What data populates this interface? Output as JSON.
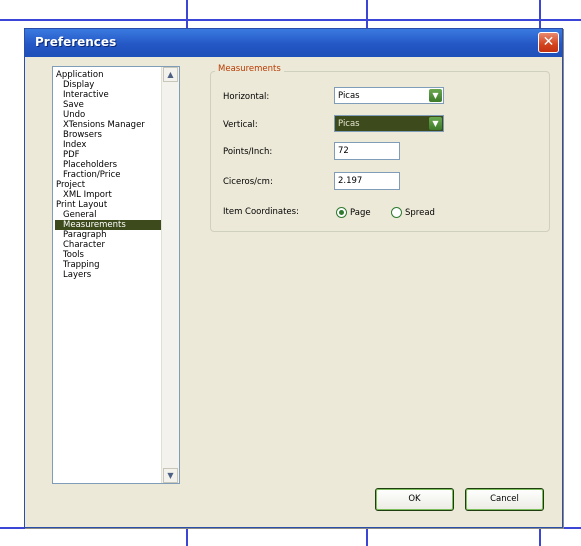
{
  "window": {
    "title": "Preferences",
    "close_glyph": "✕"
  },
  "tree": {
    "items": [
      {
        "label": "Application",
        "level": 0
      },
      {
        "label": "Display",
        "level": 1
      },
      {
        "label": "Interactive",
        "level": 1
      },
      {
        "label": "Save",
        "level": 1
      },
      {
        "label": "Undo",
        "level": 1
      },
      {
        "label": "XTensions Manager",
        "level": 1
      },
      {
        "label": "Browsers",
        "level": 1
      },
      {
        "label": "Index",
        "level": 1
      },
      {
        "label": "PDF",
        "level": 1
      },
      {
        "label": "Placeholders",
        "level": 1
      },
      {
        "label": "Fraction/Price",
        "level": 1
      },
      {
        "label": "Project",
        "level": 0
      },
      {
        "label": "XML Import",
        "level": 1
      },
      {
        "label": "Print Layout",
        "level": 0
      },
      {
        "label": "General",
        "level": 1
      },
      {
        "label": "Measurements",
        "level": 1,
        "selected": true
      },
      {
        "label": "Paragraph",
        "level": 1
      },
      {
        "label": "Character",
        "level": 1
      },
      {
        "label": "Tools",
        "level": 1
      },
      {
        "label": "Trapping",
        "level": 1
      },
      {
        "label": "Layers",
        "level": 1
      }
    ],
    "scroll_up_glyph": "▲",
    "scroll_down_glyph": "▼"
  },
  "measurements": {
    "group_title": "Measurements",
    "horizontal_label": "Horizontal:",
    "horizontal_value": "Picas",
    "vertical_label": "Vertical:",
    "vertical_value": "Picas",
    "points_label": "Points/Inch:",
    "points_value": "72",
    "ciceros_label": "Ciceros/cm:",
    "ciceros_value": "2.197",
    "item_coords_label": "Item Coordinates:",
    "radio_page": "Page",
    "radio_spread": "Spread",
    "selected_coord": "Page",
    "dropdown_glyph": "▼"
  },
  "buttons": {
    "ok": "OK",
    "cancel": "Cancel"
  },
  "colors": {
    "titlebar": "#2457c5",
    "selection": "#3d4a1c",
    "group_title": "#b83a00",
    "close": "#d3431d"
  }
}
